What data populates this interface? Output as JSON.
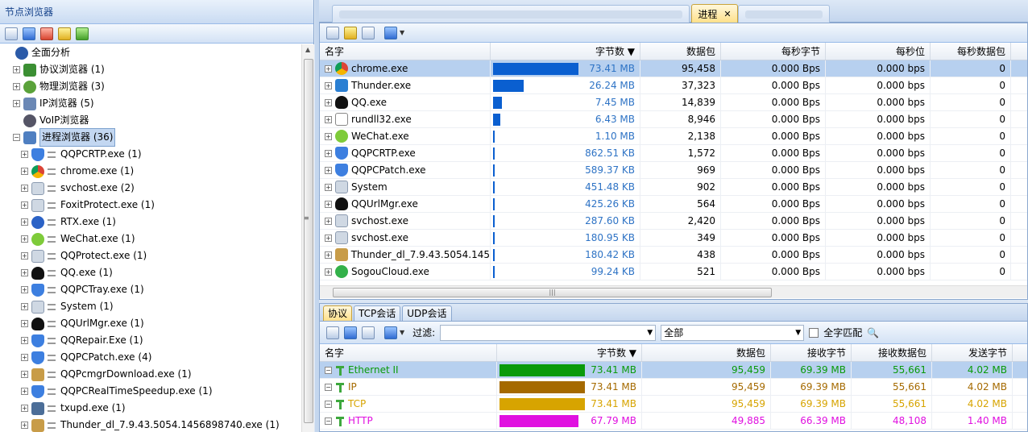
{
  "left_panel": {
    "title": "节点浏览器",
    "toolbar": [
      "add-node-icon",
      "filter-icon",
      "network-icon",
      "warning-icon",
      "settings-icon"
    ],
    "tree": [
      {
        "label": "全面分析",
        "level": 0,
        "icon": "root",
        "expand": ""
      },
      {
        "label": "协议浏览器 (1)",
        "level": 1,
        "icon": "net",
        "expand": "+"
      },
      {
        "label": "物理浏览器 (3)",
        "level": 1,
        "icon": "phy",
        "expand": "+"
      },
      {
        "label": "IP浏览器 (5)",
        "level": 1,
        "icon": "ip",
        "expand": "+"
      },
      {
        "label": "VoIP浏览器",
        "level": 1,
        "icon": "voip",
        "expand": ""
      },
      {
        "label": "进程浏览器 (36)",
        "level": 1,
        "icon": "proc",
        "expand": "−",
        "selected": true
      },
      {
        "label": "QQPCRTP.exe (1)",
        "level": 2,
        "icon": "shield",
        "expand": "+"
      },
      {
        "label": "chrome.exe (1)",
        "level": 2,
        "icon": "chrome",
        "expand": "+"
      },
      {
        "label": "svchost.exe (2)",
        "level": 2,
        "icon": "sys",
        "expand": "+"
      },
      {
        "label": "FoxitProtect.exe (1)",
        "level": 2,
        "icon": "sys",
        "expand": "+"
      },
      {
        "label": "RTX.exe (1)",
        "level": 2,
        "icon": "rtx",
        "expand": "+"
      },
      {
        "label": "WeChat.exe (1)",
        "level": 2,
        "icon": "wechat",
        "expand": "+"
      },
      {
        "label": "QQProtect.exe (1)",
        "level": 2,
        "icon": "sys",
        "expand": "+"
      },
      {
        "label": "QQ.exe (1)",
        "level": 2,
        "icon": "qq",
        "expand": "+"
      },
      {
        "label": "QQPCTray.exe (1)",
        "level": 2,
        "icon": "shield",
        "expand": "+"
      },
      {
        "label": "System (1)",
        "level": 2,
        "icon": "sys",
        "expand": "+"
      },
      {
        "label": "QQUrlMgr.exe (1)",
        "level": 2,
        "icon": "qq",
        "expand": "+"
      },
      {
        "label": "QQRepair.Exe (1)",
        "level": 2,
        "icon": "shield",
        "expand": "+"
      },
      {
        "label": "QQPCPatch.exe (4)",
        "level": 2,
        "icon": "shield",
        "expand": "+"
      },
      {
        "label": "QQPcmgrDownload.exe (1)",
        "level": 2,
        "icon": "pkg",
        "expand": "+"
      },
      {
        "label": "QQPCRealTimeSpeedup.exe (1)",
        "level": 2,
        "icon": "shield",
        "expand": "+"
      },
      {
        "label": "txupd.exe (1)",
        "level": 2,
        "icon": "upd",
        "expand": "+"
      },
      {
        "label": "Thunder_dl_7.9.43.5054.1456898740.exe (1)",
        "level": 2,
        "icon": "pkg",
        "expand": "+"
      }
    ]
  },
  "tabs": {
    "active": "进程",
    "close": "✕"
  },
  "process_table": {
    "toolbar": [
      "save-icon",
      "chart-icon",
      "export-icon",
      "refresh-icon"
    ],
    "columns": [
      "名字",
      "字节数 ▼",
      "数据包",
      "每秒字节",
      "每秒位",
      "每秒数据包"
    ],
    "rows": [
      {
        "name": "chrome.exe",
        "icon": "chrome",
        "bytes": "73.41 MB",
        "bar": 1.0,
        "packets": "95,458",
        "Bps": "0.000 Bps",
        "bps": "0.000 bps",
        "pps": "0",
        "selected": true
      },
      {
        "name": "Thunder.exe",
        "icon": "thunder",
        "bytes": "26.24 MB",
        "bar": 0.357,
        "packets": "37,323",
        "Bps": "0.000 Bps",
        "bps": "0.000 bps",
        "pps": "0"
      },
      {
        "name": "QQ.exe",
        "icon": "qq",
        "bytes": "7.45 MB",
        "bar": 0.101,
        "packets": "14,839",
        "Bps": "0.000 Bps",
        "bps": "0.000 bps",
        "pps": "0"
      },
      {
        "name": "rundll32.exe",
        "icon": "file",
        "bytes": "6.43 MB",
        "bar": 0.088,
        "packets": "8,946",
        "Bps": "0.000 Bps",
        "bps": "0.000 bps",
        "pps": "0"
      },
      {
        "name": "WeChat.exe",
        "icon": "wechat",
        "bytes": "1.10 MB",
        "bar": 0.015,
        "packets": "2,138",
        "Bps": "0.000 Bps",
        "bps": "0.000 bps",
        "pps": "0"
      },
      {
        "name": "QQPCRTP.exe",
        "icon": "shield",
        "bytes": "862.51 KB",
        "bar": 0.012,
        "packets": "1,572",
        "Bps": "0.000 Bps",
        "bps": "0.000 bps",
        "pps": "0"
      },
      {
        "name": "QQPCPatch.exe",
        "icon": "shield",
        "bytes": "589.37 KB",
        "bar": 0.008,
        "packets": "969",
        "Bps": "0.000 Bps",
        "bps": "0.000 bps",
        "pps": "0"
      },
      {
        "name": "System",
        "icon": "sys",
        "bytes": "451.48 KB",
        "bar": 0.006,
        "packets": "902",
        "Bps": "0.000 Bps",
        "bps": "0.000 bps",
        "pps": "0"
      },
      {
        "name": "QQUrlMgr.exe",
        "icon": "qq",
        "bytes": "425.26 KB",
        "bar": 0.006,
        "packets": "564",
        "Bps": "0.000 Bps",
        "bps": "0.000 bps",
        "pps": "0"
      },
      {
        "name": "svchost.exe",
        "icon": "sys",
        "bytes": "287.60 KB",
        "bar": 0.004,
        "packets": "2,420",
        "Bps": "0.000 Bps",
        "bps": "0.000 bps",
        "pps": "0"
      },
      {
        "name": "svchost.exe",
        "icon": "sys",
        "bytes": "180.95 KB",
        "bar": 0.003,
        "packets": "349",
        "Bps": "0.000 Bps",
        "bps": "0.000 bps",
        "pps": "0"
      },
      {
        "name": "Thunder_dl_7.9.43.5054.145…",
        "icon": "pkg",
        "bytes": "180.42 KB",
        "bar": 0.003,
        "packets": "438",
        "Bps": "0.000 Bps",
        "bps": "0.000 bps",
        "pps": "0"
      },
      {
        "name": "SogouCloud.exe",
        "icon": "sogou",
        "bytes": "99.24 KB",
        "bar": 0.002,
        "packets": "521",
        "Bps": "0.000 Bps",
        "bps": "0.000 bps",
        "pps": "0"
      }
    ]
  },
  "bottom": {
    "tabs": [
      "协议",
      "TCP会话",
      "UDP会话"
    ],
    "filter_label": "过滤:",
    "filter_value": "",
    "scope": "全部",
    "match_label": "全字匹配",
    "columns": [
      "名字",
      "字节数 ▼",
      "数据包",
      "接收字节",
      "接收数据包",
      "发送字节"
    ],
    "rows": [
      {
        "name": "Ethernet II",
        "level": 0,
        "bytes": "73.41 MB",
        "bar": 1.0,
        "color": "#0a9a0a",
        "packets": "95,459",
        "rx": "69.39 MB",
        "rxp": "55,661",
        "tx": "4.02 MB",
        "selected": true
      },
      {
        "name": "IP",
        "level": 1,
        "bytes": "73.41 MB",
        "bar": 1.0,
        "color": "#a56a00",
        "packets": "95,459",
        "rx": "69.39 MB",
        "rxp": "55,661",
        "tx": "4.02 MB"
      },
      {
        "name": "TCP",
        "level": 2,
        "bytes": "73.41 MB",
        "bar": 1.0,
        "color": "#d7a400",
        "packets": "95,459",
        "rx": "69.39 MB",
        "rxp": "55,661",
        "tx": "4.02 MB"
      },
      {
        "name": "HTTP",
        "level": 3,
        "bytes": "67.79 MB",
        "bar": 0.923,
        "color": "#e010e0",
        "packets": "49,885",
        "rx": "66.39 MB",
        "rxp": "48,108",
        "tx": "1.40 MB"
      }
    ]
  }
}
